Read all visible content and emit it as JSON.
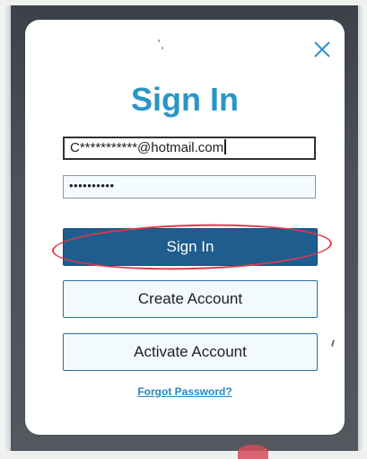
{
  "modal": {
    "title": "Sign In",
    "close_icon": "close-x-icon"
  },
  "form": {
    "email_value": "C***********@hotmail.com",
    "password_value": "••••••••••"
  },
  "buttons": {
    "sign_in": "Sign In",
    "create_account": "Create Account",
    "activate_account": "Activate Account"
  },
  "links": {
    "forgot_password": "Forgot Password?"
  },
  "colors": {
    "title": "#2a95c7",
    "primary_button": "#1e5d8e",
    "outline_border": "#2a6f9f",
    "annotation_oval": "#dd3a4a",
    "link": "#2a86c0"
  }
}
